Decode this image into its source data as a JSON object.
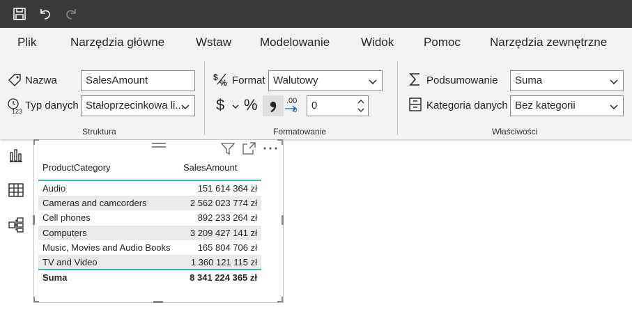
{
  "menu": {
    "items": [
      "Plik",
      "Narzędzia główne",
      "Wstaw",
      "Modelowanie",
      "Widok",
      "Pomoc",
      "Narzędzia zewnętrzne"
    ]
  },
  "ribbon": {
    "structure": {
      "name_label": "Nazwa",
      "name_value": "SalesAmount",
      "datatype_label": "Typ danych",
      "datatype_value": "Stałoprzecinkowa li...",
      "group_label": "Struktura"
    },
    "formatting": {
      "format_label": "Format",
      "format_value": "Walutowy",
      "currency_symbol": "$",
      "percent_symbol": "%",
      "decimals_value": "0",
      "group_label": "Formatowanie"
    },
    "properties": {
      "summarize_label": "Podsumowanie",
      "summarize_value": "Suma",
      "category_label": "Kategoria danych",
      "category_value": "Bez kategorii",
      "group_label": "Właściwości"
    }
  },
  "table": {
    "headers": [
      "ProductCategory",
      "SalesAmount"
    ],
    "rows": [
      {
        "category": "Audio",
        "amount": "151 614 364 zł"
      },
      {
        "category": "Cameras and camcorders",
        "amount": "2 562 023 774 zł"
      },
      {
        "category": "Cell phones",
        "amount": "892 233 264 zł"
      },
      {
        "category": "Computers",
        "amount": "3 209 427 141 zł"
      },
      {
        "category": "Music, Movies and Audio Books",
        "amount": "165 804 706 zł"
      },
      {
        "category": "TV and Video",
        "amount": "1 360 121 115 zł"
      }
    ],
    "total_label": "Suma",
    "total_value": "8 341 224 365 zł"
  },
  "colors": {
    "titlebar": "#3b3a39",
    "ribbon_bg": "#f3f2f1",
    "accent_teal": "#33b5b0",
    "decimal_arrow": "#2b88d8"
  },
  "icons": [
    "save-icon",
    "undo-icon",
    "redo-icon",
    "tag-icon",
    "clock-123-icon",
    "currency-percent-icon",
    "dollar-icon",
    "chevron-down-icon",
    "percent-icon",
    "comma-icon",
    "decimal-increase-icon",
    "sigma-icon",
    "category-icon",
    "report-view-icon",
    "data-view-icon",
    "model-view-icon",
    "drag-handle-icon",
    "filter-icon",
    "focus-mode-icon",
    "more-options-icon"
  ]
}
